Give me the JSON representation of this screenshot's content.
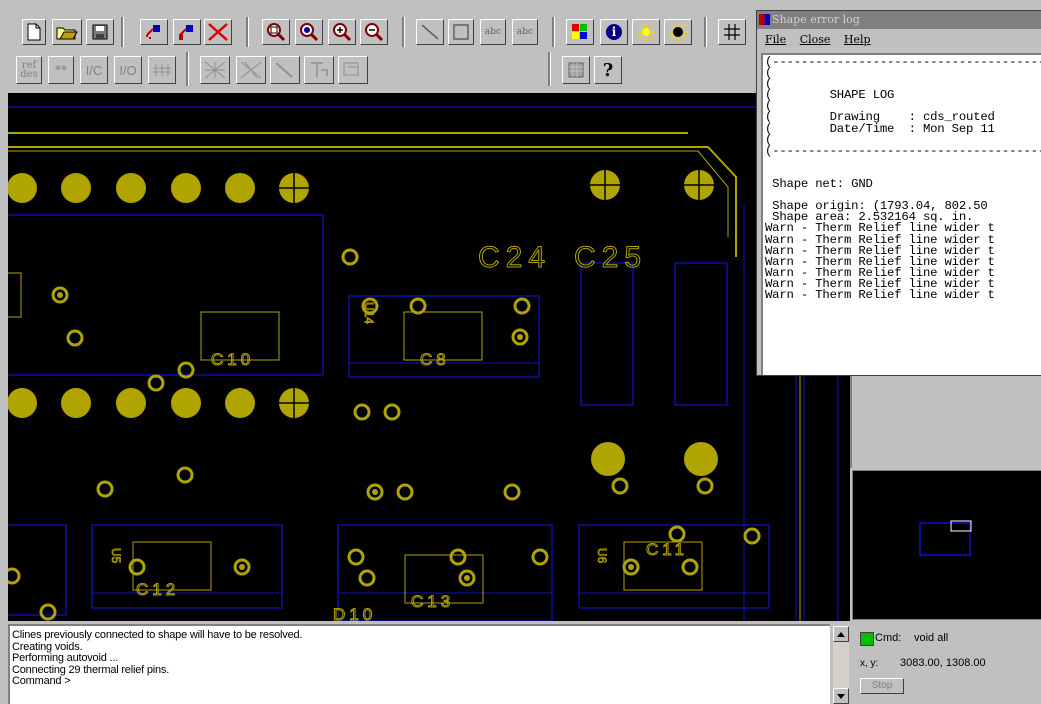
{
  "toolbar": {
    "row1": [
      {
        "name": "new-file-button",
        "icon": "new-file-icon"
      },
      {
        "name": "open-file-button",
        "icon": "folder-icon"
      },
      {
        "name": "save-file-button",
        "icon": "floppy-icon"
      },
      {
        "name": "add-connect-button",
        "icon": "add-connect-icon"
      },
      {
        "name": "slide-button",
        "icon": "slide-icon"
      },
      {
        "name": "delete-button",
        "icon": "delete-x-icon"
      },
      {
        "name": "zoom-fit-button",
        "icon": "zoom-fit-icon"
      },
      {
        "name": "zoom-world-button",
        "icon": "zoom-world-icon"
      },
      {
        "name": "zoom-in-button",
        "icon": "zoom-in-icon"
      },
      {
        "name": "zoom-out-button",
        "icon": "zoom-out-icon"
      },
      {
        "name": "add-line-button",
        "icon": "line-icon"
      },
      {
        "name": "add-rect-button",
        "icon": "rectangle-icon"
      },
      {
        "name": "add-text-button",
        "icon": "text-icon",
        "label": "abc"
      },
      {
        "name": "change-text-button",
        "icon": "change-text-icon",
        "label": "abc"
      },
      {
        "name": "color-button",
        "icon": "color-grid-icon"
      },
      {
        "name": "info-button",
        "icon": "info-icon"
      },
      {
        "name": "highlight-button",
        "icon": "sun-icon"
      },
      {
        "name": "dehighlight-button",
        "icon": "dark-sun-icon"
      },
      {
        "name": "grid-button",
        "icon": "grid-icon"
      }
    ],
    "row2": [
      {
        "name": "refdes-button",
        "icon": "refdes-icon",
        "label": "ref des"
      },
      {
        "name": "asterisk-button",
        "icon": "asterisk-icon",
        "label": "**"
      },
      {
        "name": "ic-button",
        "icon": "ic-icon",
        "label": "I/C"
      },
      {
        "name": "io-button",
        "icon": "io-icon",
        "label": "I/O"
      },
      {
        "name": "pins-button",
        "icon": "pins-icon"
      },
      {
        "name": "route-button",
        "icon": "route-icon"
      },
      {
        "name": "unroute-button",
        "icon": "unroute-icon"
      },
      {
        "name": "slide-line-button",
        "icon": "slide-line-icon"
      },
      {
        "name": "text-edit-button",
        "icon": "text-edit-icon"
      },
      {
        "name": "shape-button",
        "icon": "shape-icon"
      },
      {
        "name": "display-button",
        "icon": "display-icon"
      },
      {
        "name": "help-button",
        "icon": "question-icon"
      }
    ]
  },
  "canvas": {
    "labels": {
      "c24": "C24",
      "c25": "C25",
      "c10": "C10",
      "c8": "C8",
      "c12": "C12",
      "c13": "C13",
      "c11": "C11",
      "u14": "U14",
      "u5": "U5",
      "u6": "U6",
      "d10": "D10"
    },
    "colors": {
      "pad": "#b0a400",
      "outline": "#1010c8",
      "background": "#000000"
    }
  },
  "log_window": {
    "title": "Shape error log",
    "menu": [
      "File",
      "Close",
      "Help"
    ],
    "body": "(----------------------------------------\n(\n(\n(        SHAPE LOG\n(\n(        Drawing    : cds_routed\n(        Date/Time  : Mon Sep 11\n(\n(----------------------------------------\n\n\n Shape net: GND\n\n Shape origin: (1793.04, 802.50\n Shape area: 2.532164 sq. in.\nWarn - Therm Relief line wider t\nWarn - Therm Relief line wider t\nWarn - Therm Relief line wider t\nWarn - Therm Relief line wider t\nWarn - Therm Relief line wider t\nWarn - Therm Relief line wider t\nWarn - Therm Relief line wider t"
  },
  "console": {
    "lines": [
      "Clines previously connected to shape will have to be resolved.",
      "Creating voids.",
      "Performing autovoid ...",
      "Connecting 29 thermal relief pins.",
      "Command >"
    ]
  },
  "status": {
    "cmd_label": "Cmd:",
    "cmd_value": "void all",
    "xy_label": "x, y:",
    "xy_value": "3083.00, 1308.00",
    "stop_label": "Stop",
    "indicator_color": "#00c000"
  }
}
